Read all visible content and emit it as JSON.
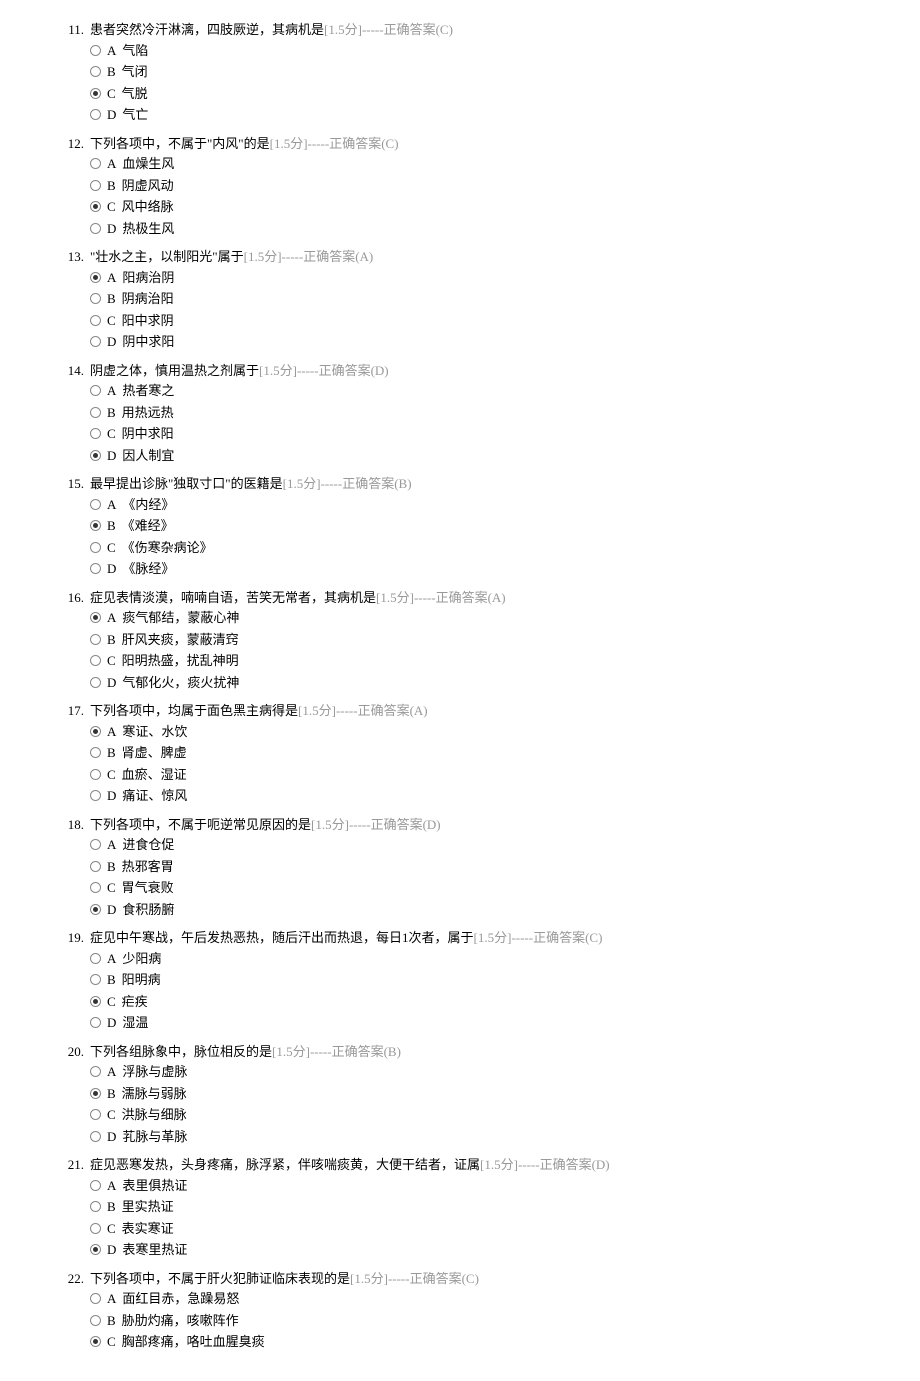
{
  "questions": [
    {
      "num": "11.",
      "text": "患者突然冷汗淋漓，四肢厥逆，其病机是",
      "score": "[1.5分]",
      "answer": "-----正确答案(C)",
      "selected": 2,
      "options": [
        {
          "letter": "A",
          "text": " 气陷"
        },
        {
          "letter": "B",
          "text": " 气闭"
        },
        {
          "letter": "C",
          "text": " 气脱"
        },
        {
          "letter": "D",
          "text": " 气亡"
        }
      ]
    },
    {
      "num": "12.",
      "text": "下列各项中，不属于\"内风\"的是",
      "score": "[1.5分]",
      "answer": "-----正确答案(C)",
      "selected": 2,
      "options": [
        {
          "letter": "A",
          "text": " 血燥生风"
        },
        {
          "letter": "B",
          "text": " 阴虚风动"
        },
        {
          "letter": "C",
          "text": " 风中络脉"
        },
        {
          "letter": "D",
          "text": " 热极生风"
        }
      ]
    },
    {
      "num": "13.",
      "text": "\"壮水之主，以制阳光\"属于",
      "score": "[1.5分]",
      "answer": "-----正确答案(A)",
      "selected": 0,
      "options": [
        {
          "letter": "A",
          "text": " 阳病治阴"
        },
        {
          "letter": "B",
          "text": " 阴病治阳"
        },
        {
          "letter": "C",
          "text": " 阳中求阴"
        },
        {
          "letter": "D",
          "text": " 阴中求阳"
        }
      ]
    },
    {
      "num": "14.",
      "text": "阴虚之体，慎用温热之剂属于",
      "score": "[1.5分]",
      "answer": "-----正确答案(D)",
      "selected": 3,
      "options": [
        {
          "letter": "A",
          "text": " 热者寒之"
        },
        {
          "letter": "B",
          "text": " 用热远热"
        },
        {
          "letter": "C",
          "text": " 阴中求阳"
        },
        {
          "letter": "D",
          "text": " 因人制宜"
        }
      ]
    },
    {
      "num": "15.",
      "text": "最早提出诊脉\"独取寸口\"的医籍是",
      "score": "[1.5分]",
      "answer": "-----正确答案(B)",
      "selected": 1,
      "options": [
        {
          "letter": "A",
          "text": " 《内经》"
        },
        {
          "letter": "B",
          "text": " 《难经》"
        },
        {
          "letter": "C",
          "text": " 《伤寒杂病论》"
        },
        {
          "letter": "D",
          "text": " 《脉经》"
        }
      ]
    },
    {
      "num": "16.",
      "text": "症见表情淡漠，喃喃自语，苦笑无常者，其病机是",
      "score": "[1.5分]",
      "answer": "-----正确答案(A)",
      "selected": 0,
      "options": [
        {
          "letter": "A",
          "text": " 痰气郁结，蒙蔽心神"
        },
        {
          "letter": "B",
          "text": " 肝风夹痰，蒙蔽清窍"
        },
        {
          "letter": "C",
          "text": " 阳明热盛，扰乱神明"
        },
        {
          "letter": "D",
          "text": " 气郁化火，痰火扰神"
        }
      ]
    },
    {
      "num": "17.",
      "text": "下列各项中，均属于面色黑主病得是",
      "score": "[1.5分]",
      "answer": "-----正确答案(A)",
      "selected": 0,
      "options": [
        {
          "letter": "A",
          "text": " 寒证、水饮"
        },
        {
          "letter": "B",
          "text": " 肾虚、脾虚"
        },
        {
          "letter": "C",
          "text": " 血瘀、湿证"
        },
        {
          "letter": "D",
          "text": " 痛证、惊风"
        }
      ]
    },
    {
      "num": "18.",
      "text": "下列各项中，不属于呃逆常见原因的是",
      "score": "[1.5分]",
      "answer": "-----正确答案(D)",
      "selected": 3,
      "options": [
        {
          "letter": "A",
          "text": " 进食仓促"
        },
        {
          "letter": "B",
          "text": " 热邪客胃"
        },
        {
          "letter": "C",
          "text": " 胃气衰败"
        },
        {
          "letter": "D",
          "text": " 食积肠腑"
        }
      ]
    },
    {
      "num": "19.",
      "text": "症见中午寒战，午后发热恶热，随后汗出而热退，每日1次者，属于",
      "score": "[1.5分]",
      "answer": "-----正确答案(C)",
      "selected": 2,
      "options": [
        {
          "letter": "A",
          "text": " 少阳病"
        },
        {
          "letter": "B",
          "text": " 阳明病"
        },
        {
          "letter": "C",
          "text": " 疟疾"
        },
        {
          "letter": "D",
          "text": " 湿温"
        }
      ]
    },
    {
      "num": "20.",
      "text": "下列各组脉象中，脉位相反的是",
      "score": "[1.5分]",
      "answer": "-----正确答案(B)",
      "selected": 1,
      "options": [
        {
          "letter": "A",
          "text": " 浮脉与虚脉"
        },
        {
          "letter": "B",
          "text": " 濡脉与弱脉"
        },
        {
          "letter": "C",
          "text": " 洪脉与细脉"
        },
        {
          "letter": "D",
          "text": " 芤脉与革脉"
        }
      ]
    },
    {
      "num": "21.",
      "text": "症见恶寒发热，头身疼痛，脉浮紧，伴咳喘痰黄，大便干结者，证属",
      "score": "[1.5分]",
      "answer": "-----正确答案(D)",
      "selected": 3,
      "options": [
        {
          "letter": "A",
          "text": " 表里俱热证"
        },
        {
          "letter": "B",
          "text": " 里实热证"
        },
        {
          "letter": "C",
          "text": " 表实寒证"
        },
        {
          "letter": "D",
          "text": " 表寒里热证"
        }
      ]
    },
    {
      "num": "22.",
      "text": "下列各项中，不属于肝火犯肺证临床表现的是",
      "score": "[1.5分]",
      "answer": "-----正确答案(C)",
      "selected": 2,
      "options": [
        {
          "letter": "A",
          "text": " 面红目赤，急躁易怒"
        },
        {
          "letter": "B",
          "text": " 胁肋灼痛，咳嗽阵作"
        },
        {
          "letter": "C",
          "text": " 胸部疼痛，咯吐血腥臭痰"
        }
      ]
    }
  ]
}
